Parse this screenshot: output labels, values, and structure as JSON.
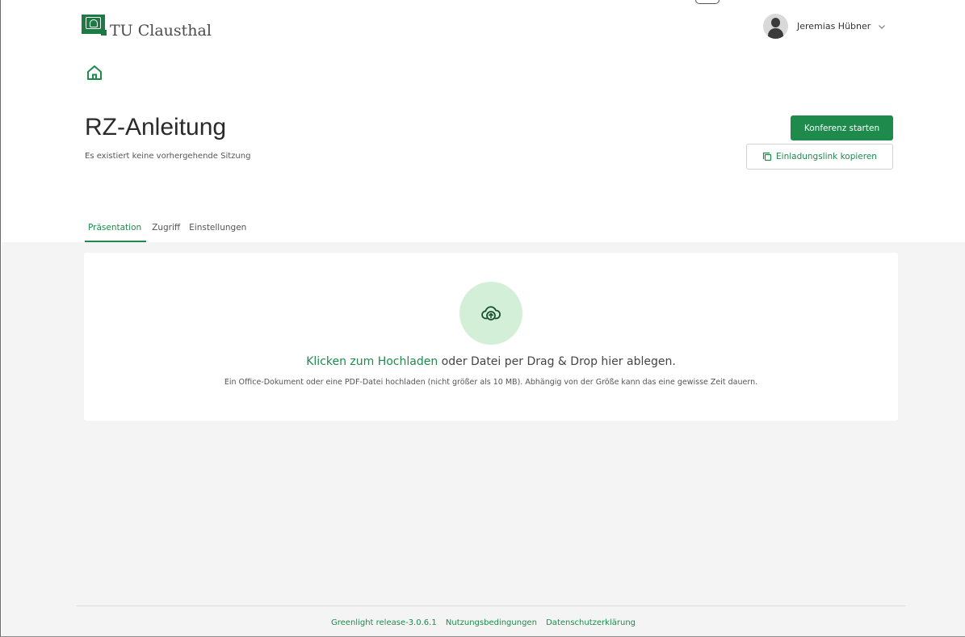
{
  "brand": {
    "name": "TU Clausthal",
    "accent": "#1e8a4c"
  },
  "header": {
    "user_name": "Jeremias Hübner",
    "icons": {
      "avatar": "user-avatar",
      "dropdown": "chevron-down-icon",
      "home": "home-icon"
    }
  },
  "room": {
    "title": "RZ-Anleitung",
    "subtitle": "Es existiert keine vorhergehende Sitzung",
    "start_button": "Konferenz starten",
    "copy_button": "Einladungslink kopieren"
  },
  "tabs": [
    {
      "label": "Präsentation",
      "active": true
    },
    {
      "label": "Zugriff",
      "active": false
    },
    {
      "label": "Einstellungen",
      "active": false
    }
  ],
  "upload": {
    "link_text": "Klicken zum Hochladen",
    "rest_text": " oder Datei per Drag & Drop hier ablegen.",
    "hint": "Ein Office-Dokument oder eine PDF-Datei hochladen (nicht größer als 10 MB). Abhängig von der Größe kann das eine gewisse Zeit dauern.",
    "icon": "cloud-upload-icon"
  },
  "footer": {
    "release": "Greenlight release-3.0.6.1",
    "terms": "Nutzungsbedingungen",
    "privacy": "Datenschutzerklärung"
  }
}
